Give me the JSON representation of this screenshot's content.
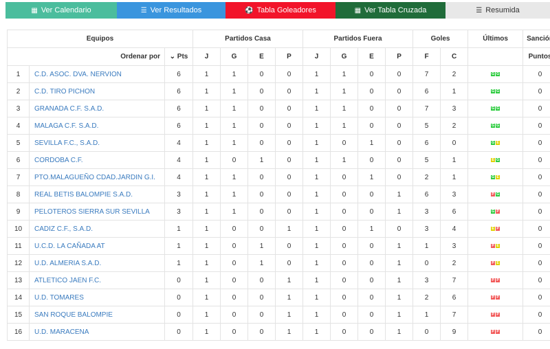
{
  "tabs": [
    {
      "label": "Ver Calendario",
      "icon": "calendar-icon",
      "glyph": "▦"
    },
    {
      "label": "Ver Resultados",
      "icon": "list-icon",
      "glyph": "☰"
    },
    {
      "label": "Tabla Goleadores",
      "icon": "soccer-ball-icon",
      "glyph": "⚽"
    },
    {
      "label": "Ver Tabla Cruzada",
      "icon": "table-icon",
      "glyph": "▦"
    },
    {
      "label": "Resumida",
      "icon": "list-icon",
      "glyph": "☰"
    }
  ],
  "header": {
    "equipos": "Equipos",
    "casa": "Partidos Casa",
    "fuera": "Partidos Fuera",
    "goles": "Goles",
    "ultimos": "Últimos",
    "sancion": "Sanción",
    "ordenar": "Ordenar por",
    "pts": "Pts",
    "j": "J",
    "g": "G",
    "e": "E",
    "p": "P",
    "f": "F",
    "c": "C",
    "puntos": "Puntos"
  },
  "colors": {
    "win": "#2ecc40",
    "draw": "#e0d000",
    "loss": "#f25a5a",
    "link": "#3a7bbf"
  },
  "rows": [
    {
      "pos": "1",
      "team": "C.D. ASOC. DVA. NERVION",
      "pts": "6",
      "hj": "1",
      "hg": "1",
      "he": "0",
      "hp": "0",
      "aj": "1",
      "ag": "1",
      "ae": "0",
      "ap": "0",
      "f": "7",
      "c": "2",
      "last": [
        "G",
        "G"
      ],
      "sancion": "0"
    },
    {
      "pos": "2",
      "team": "C.D. TIRO PICHON",
      "pts": "6",
      "hj": "1",
      "hg": "1",
      "he": "0",
      "hp": "0",
      "aj": "1",
      "ag": "1",
      "ae": "0",
      "ap": "0",
      "f": "6",
      "c": "1",
      "last": [
        "G",
        "G"
      ],
      "sancion": "0"
    },
    {
      "pos": "3",
      "team": "GRANADA C.F. S.A.D.",
      "pts": "6",
      "hj": "1",
      "hg": "1",
      "he": "0",
      "hp": "0",
      "aj": "1",
      "ag": "1",
      "ae": "0",
      "ap": "0",
      "f": "7",
      "c": "3",
      "last": [
        "G",
        "G"
      ],
      "sancion": "0"
    },
    {
      "pos": "4",
      "team": "MALAGA C.F. S.A.D.",
      "pts": "6",
      "hj": "1",
      "hg": "1",
      "he": "0",
      "hp": "0",
      "aj": "1",
      "ag": "1",
      "ae": "0",
      "ap": "0",
      "f": "5",
      "c": "2",
      "last": [
        "G",
        "G"
      ],
      "sancion": "0"
    },
    {
      "pos": "5",
      "team": "SEVILLA F.C., S.A.D.",
      "pts": "4",
      "hj": "1",
      "hg": "1",
      "he": "0",
      "hp": "0",
      "aj": "1",
      "ag": "0",
      "ae": "1",
      "ap": "0",
      "f": "6",
      "c": "0",
      "last": [
        "G",
        "E"
      ],
      "sancion": "0"
    },
    {
      "pos": "6",
      "team": "CORDOBA C.F.",
      "pts": "4",
      "hj": "1",
      "hg": "0",
      "he": "1",
      "hp": "0",
      "aj": "1",
      "ag": "1",
      "ae": "0",
      "ap": "0",
      "f": "5",
      "c": "1",
      "last": [
        "E",
        "G"
      ],
      "sancion": "0"
    },
    {
      "pos": "7",
      "team": "PTO.MALAGUEÑO CDAD.JARDIN G.I.",
      "pts": "4",
      "hj": "1",
      "hg": "1",
      "he": "0",
      "hp": "0",
      "aj": "1",
      "ag": "0",
      "ae": "1",
      "ap": "0",
      "f": "2",
      "c": "1",
      "last": [
        "G",
        "E"
      ],
      "sancion": "0"
    },
    {
      "pos": "8",
      "team": "REAL BETIS BALOMPIE S.A.D.",
      "pts": "3",
      "hj": "1",
      "hg": "1",
      "he": "0",
      "hp": "0",
      "aj": "1",
      "ag": "0",
      "ae": "0",
      "ap": "1",
      "f": "6",
      "c": "3",
      "last": [
        "P",
        "G"
      ],
      "sancion": "0"
    },
    {
      "pos": "9",
      "team": "PELOTEROS SIERRA SUR SEVILLA",
      "pts": "3",
      "hj": "1",
      "hg": "1",
      "he": "0",
      "hp": "0",
      "aj": "1",
      "ag": "0",
      "ae": "0",
      "ap": "1",
      "f": "3",
      "c": "6",
      "last": [
        "G",
        "P"
      ],
      "sancion": "0"
    },
    {
      "pos": "10",
      "team": "CADIZ C.F., S.A.D.",
      "pts": "1",
      "hj": "1",
      "hg": "0",
      "he": "0",
      "hp": "1",
      "aj": "1",
      "ag": "0",
      "ae": "1",
      "ap": "0",
      "f": "3",
      "c": "4",
      "last": [
        "E",
        "P"
      ],
      "sancion": "0"
    },
    {
      "pos": "11",
      "team": "U.C.D. LA CAÑADA AT",
      "pts": "1",
      "hj": "1",
      "hg": "0",
      "he": "1",
      "hp": "0",
      "aj": "1",
      "ag": "0",
      "ae": "0",
      "ap": "1",
      "f": "1",
      "c": "3",
      "last": [
        "P",
        "E"
      ],
      "sancion": "0"
    },
    {
      "pos": "12",
      "team": "U.D. ALMERIA S.A.D.",
      "pts": "1",
      "hj": "1",
      "hg": "0",
      "he": "1",
      "hp": "0",
      "aj": "1",
      "ag": "0",
      "ae": "0",
      "ap": "1",
      "f": "0",
      "c": "2",
      "last": [
        "P",
        "E"
      ],
      "sancion": "0"
    },
    {
      "pos": "13",
      "team": "ATLETICO JAEN F.C.",
      "pts": "0",
      "hj": "1",
      "hg": "0",
      "he": "0",
      "hp": "1",
      "aj": "1",
      "ag": "0",
      "ae": "0",
      "ap": "1",
      "f": "3",
      "c": "7",
      "last": [
        "P",
        "P"
      ],
      "sancion": "0"
    },
    {
      "pos": "14",
      "team": "U.D. TOMARES",
      "pts": "0",
      "hj": "1",
      "hg": "0",
      "he": "0",
      "hp": "1",
      "aj": "1",
      "ag": "0",
      "ae": "0",
      "ap": "1",
      "f": "2",
      "c": "6",
      "last": [
        "P",
        "P"
      ],
      "sancion": "0"
    },
    {
      "pos": "15",
      "team": "SAN ROQUE BALOMPIE",
      "pts": "0",
      "hj": "1",
      "hg": "0",
      "he": "0",
      "hp": "1",
      "aj": "1",
      "ag": "0",
      "ae": "0",
      "ap": "1",
      "f": "1",
      "c": "7",
      "last": [
        "P",
        "P"
      ],
      "sancion": "0"
    },
    {
      "pos": "16",
      "team": "U.D. MARACENA",
      "pts": "0",
      "hj": "1",
      "hg": "0",
      "he": "0",
      "hp": "1",
      "aj": "1",
      "ag": "0",
      "ae": "0",
      "ap": "1",
      "f": "0",
      "c": "9",
      "last": [
        "P",
        "P"
      ],
      "sancion": "0"
    }
  ]
}
